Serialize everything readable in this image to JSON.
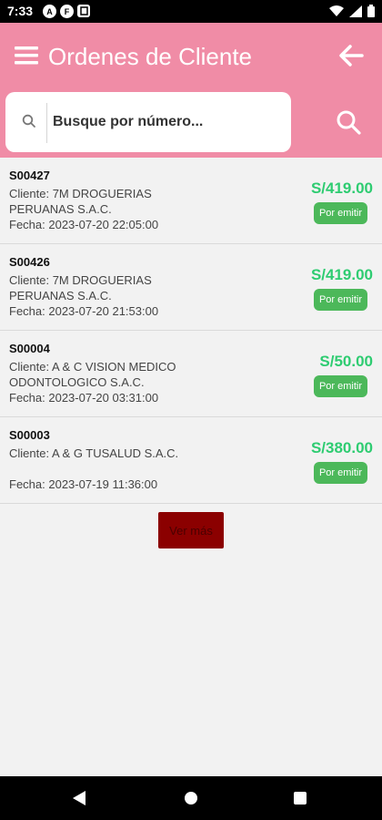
{
  "status_bar": {
    "time": "7:33",
    "left_icons": [
      "A",
      "F"
    ],
    "right_icons": [
      "wifi-icon",
      "signal-icon",
      "battery-icon"
    ]
  },
  "app_bar": {
    "title": "Ordenes de Cliente",
    "menu_icon": "hamburger-menu-icon",
    "back_icon": "arrow-back-icon"
  },
  "search": {
    "placeholder": "Busque por número...",
    "value": "",
    "search_icon": "search-icon"
  },
  "orders": [
    {
      "number": "S00427",
      "client": "Cliente: 7M DROGUERIAS PERUANAS S.A.C.",
      "date": "Fecha: 2023-07-20 22:05:00",
      "amount": "S/419.00",
      "status": "Por emitir"
    },
    {
      "number": "S00426",
      "client": "Cliente: 7M DROGUERIAS PERUANAS S.A.C.",
      "date": "Fecha: 2023-07-20 21:53:00",
      "amount": "S/419.00",
      "status": "Por emitir"
    },
    {
      "number": "S00004",
      "client": "Cliente: A & C VISION MEDICO ODONTOLOGICO S.A.C.",
      "date": "Fecha: 2023-07-20 03:31:00",
      "amount": "S/50.00",
      "status": "Por emitir"
    },
    {
      "number": "S00003",
      "client": "Cliente: A & G TUSALUD S.A.C.",
      "date": "Fecha: 2023-07-19 11:36:00",
      "amount": "S/380.00",
      "status": "Por emitir"
    }
  ],
  "load_more_label": "Ver más",
  "colors": {
    "app_bar": "#f08ca6",
    "amount": "#2ecc71",
    "status_badge": "#4cb85a",
    "load_more": "#8b0000"
  }
}
